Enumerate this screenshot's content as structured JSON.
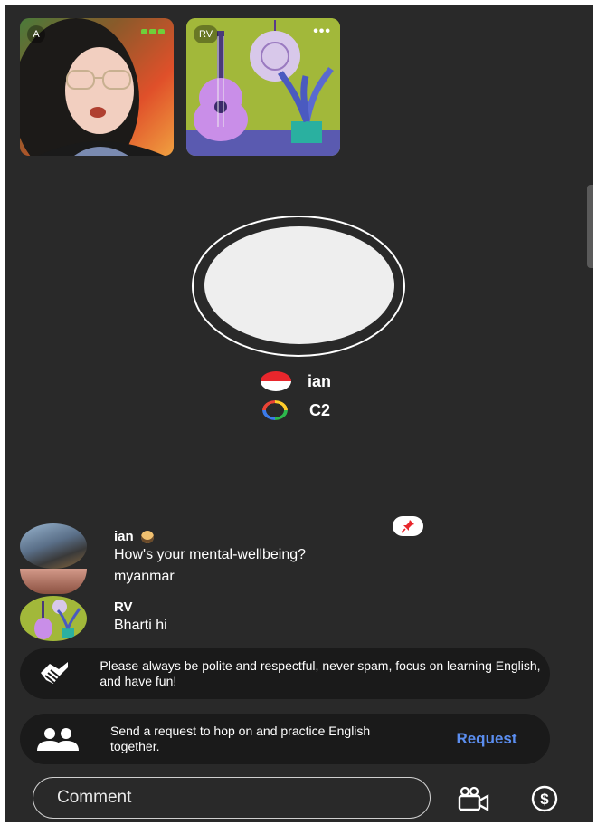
{
  "participants": [
    {
      "badge": "A"
    },
    {
      "badge": "RV"
    }
  ],
  "host": {
    "name": "ian",
    "level": "C2",
    "flag_icon": "indonesia-flag-icon",
    "level_icon": "level-ring-icon"
  },
  "chat": [
    {
      "name": "ian",
      "text": "How's your mental-wellbeing?"
    },
    {
      "text": "myanmar"
    },
    {
      "name": "RV",
      "text": "Bharti hi"
    }
  ],
  "rules_banner": {
    "text": "Please always be polite and respectful, never spam, focus on learning English, and have fun!"
  },
  "request_banner": {
    "text": "Send a request to hop on and practice English together.",
    "button": "Request"
  },
  "comment": {
    "placeholder": "Comment"
  },
  "colors": {
    "background": "#292929",
    "banner": "#1a1a1a",
    "accent": "#5b8ef0",
    "flag_red": "#e8262c"
  }
}
